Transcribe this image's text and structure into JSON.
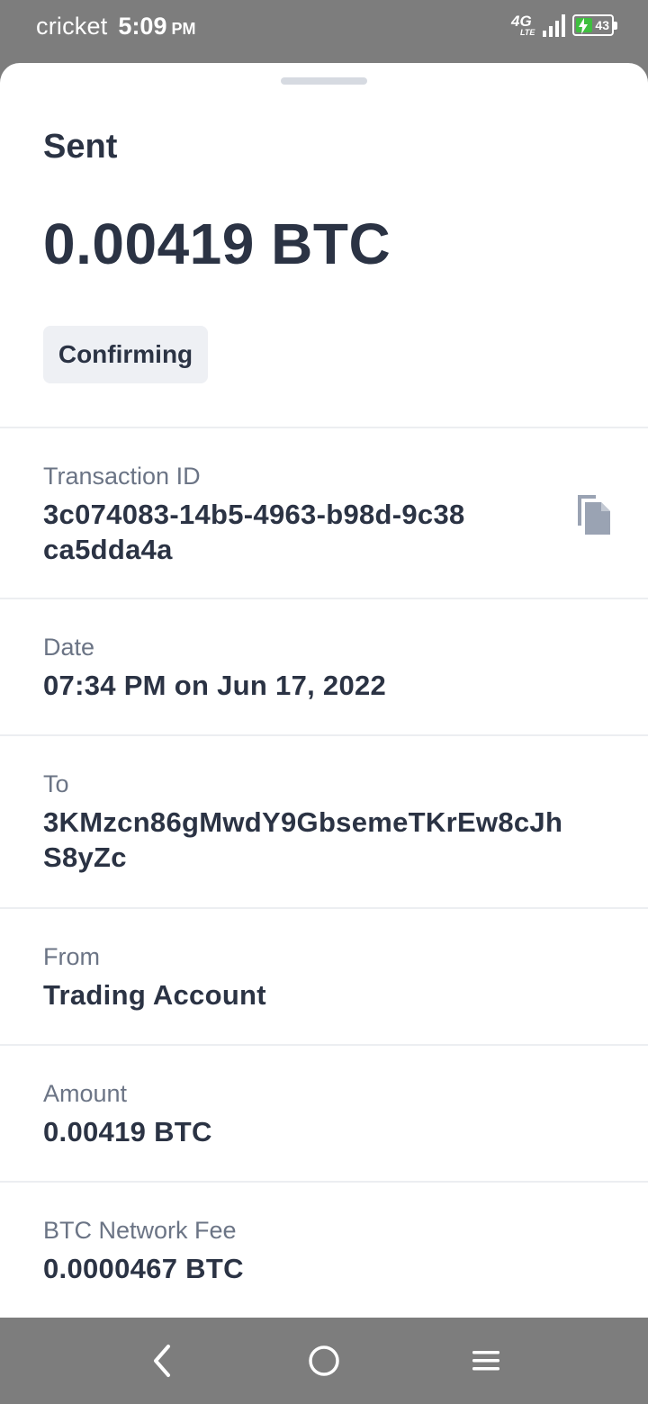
{
  "status_bar": {
    "carrier": "cricket",
    "time": "5:09",
    "ampm": "PM",
    "network": "4G",
    "network_sub": "LTE",
    "battery_level": "43",
    "battery_charging": true
  },
  "sheet": {
    "title": "Sent",
    "amount": "0.00419 BTC",
    "status": "Confirming"
  },
  "details": {
    "transaction_id_label": "Transaction ID",
    "transaction_id_line1": "3c074083-14b5-4963-b98d-9c38",
    "transaction_id_line2": "ca5dda4a",
    "date_label": "Date",
    "date_value": "07:34 PM on Jun 17, 2022",
    "to_label": "To",
    "to_line1": "3KMzcn86gMwdY9GbsemeTKrEw8cJh",
    "to_line2": "S8yZc",
    "from_label": "From",
    "from_value": "Trading Account",
    "amount_label": "Amount",
    "amount_value": "0.00419 BTC",
    "fee_label": "BTC Network Fee",
    "fee_value": "0.0000467 BTC"
  },
  "icons": {
    "copy": "copy-icon",
    "back": "back-icon",
    "home": "home-icon",
    "menu": "menu-icon"
  },
  "colors": {
    "text_primary": "#2b3344",
    "text_secondary": "#6b7485",
    "chip_bg": "#eef0f4",
    "divider": "#eceef1",
    "system_bars": "#7d7d7d",
    "battery_green": "#3fbf3f",
    "icon_gray": "#9aa3b3"
  }
}
